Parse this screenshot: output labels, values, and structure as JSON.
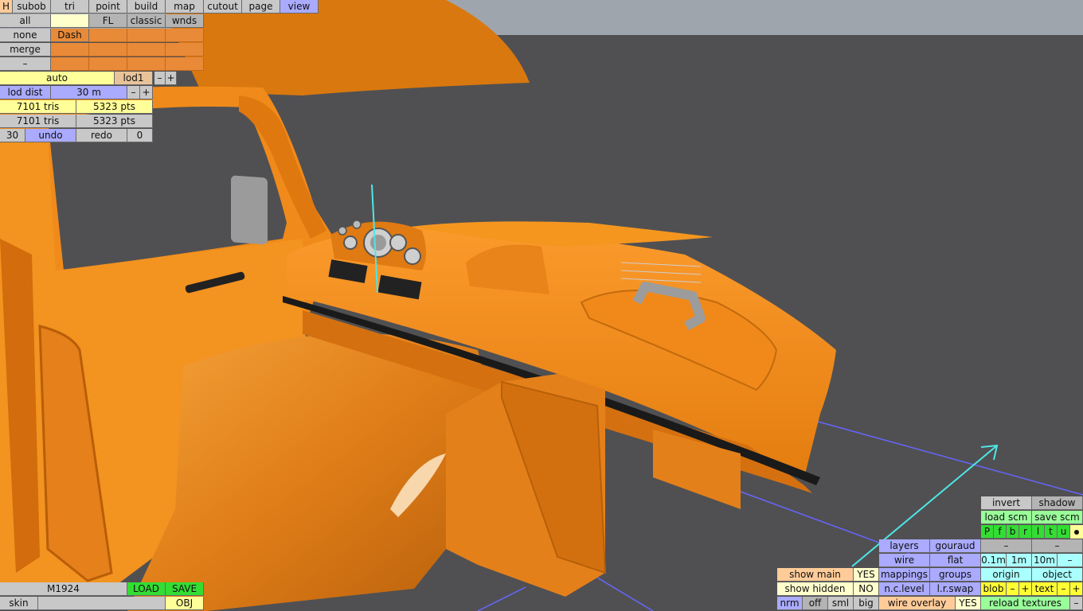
{
  "colors": {
    "sky": "#9fa5ac",
    "ground": "#505052",
    "car_orange": "#f28c1c",
    "gizmo_cyan": "#4ee6e6",
    "gizmo_blue": "#6666ff"
  },
  "top_tabs": [
    "H",
    "subob",
    "tri",
    "point",
    "build",
    "map",
    "cutout",
    "page",
    "view"
  ],
  "select": {
    "all": "all",
    "none": "none",
    "merge": "merge",
    "minus": "–",
    "fl": "FL",
    "classic": "classic",
    "wnds": "wnds",
    "layer_dash": "Dash"
  },
  "lod": {
    "mode": "auto",
    "level": "lod1",
    "minus": "–",
    "plus": "+",
    "dist_label": "lod dist",
    "dist_value": "30 m",
    "tris1": "7101 tris",
    "pts1": "5323 pts",
    "tris2": "7101 tris",
    "pts2": "5323 pts",
    "count": "30",
    "undo": "undo",
    "redo": "redo",
    "zero": "0"
  },
  "file": {
    "name": "M1924",
    "load": "LOAD",
    "save": "SAVE",
    "skin": "skin",
    "obj": "OBJ"
  },
  "view_panel": {
    "show_main": "show main",
    "show_main_val": "YES",
    "show_hidden": "show hidden",
    "show_hidden_val": "NO",
    "nrm": "nrm",
    "off": "off",
    "sml": "sml",
    "big": "big",
    "layers": "layers",
    "gouraud": "gouraud",
    "wire": "wire",
    "flat": "flat",
    "mappings": "mappings",
    "groups": "groups",
    "nc_level": "n.c.level",
    "lr_swap": "l.r.swap",
    "wire_overlay": "wire overlay",
    "wire_overlay_val": "YES",
    "invert": "invert",
    "shadow": "shadow",
    "load_scm": "load scm",
    "save_scm": "save scm",
    "axis_letters": [
      "P",
      "f",
      "b",
      "r",
      "l",
      "t",
      "u"
    ],
    "dash1": "–",
    "dash2": "–",
    "step_01": "0.1m",
    "step_1": "1m",
    "step_10": "10m",
    "step_minus": "–",
    "origin": "origin",
    "object": "object",
    "blob": "blob",
    "blob_minus": "–",
    "blob_plus": "+",
    "text": "text",
    "text_minus": "–",
    "text_plus": "+",
    "reload_textures": "reload textures",
    "reload_minus": "–"
  }
}
